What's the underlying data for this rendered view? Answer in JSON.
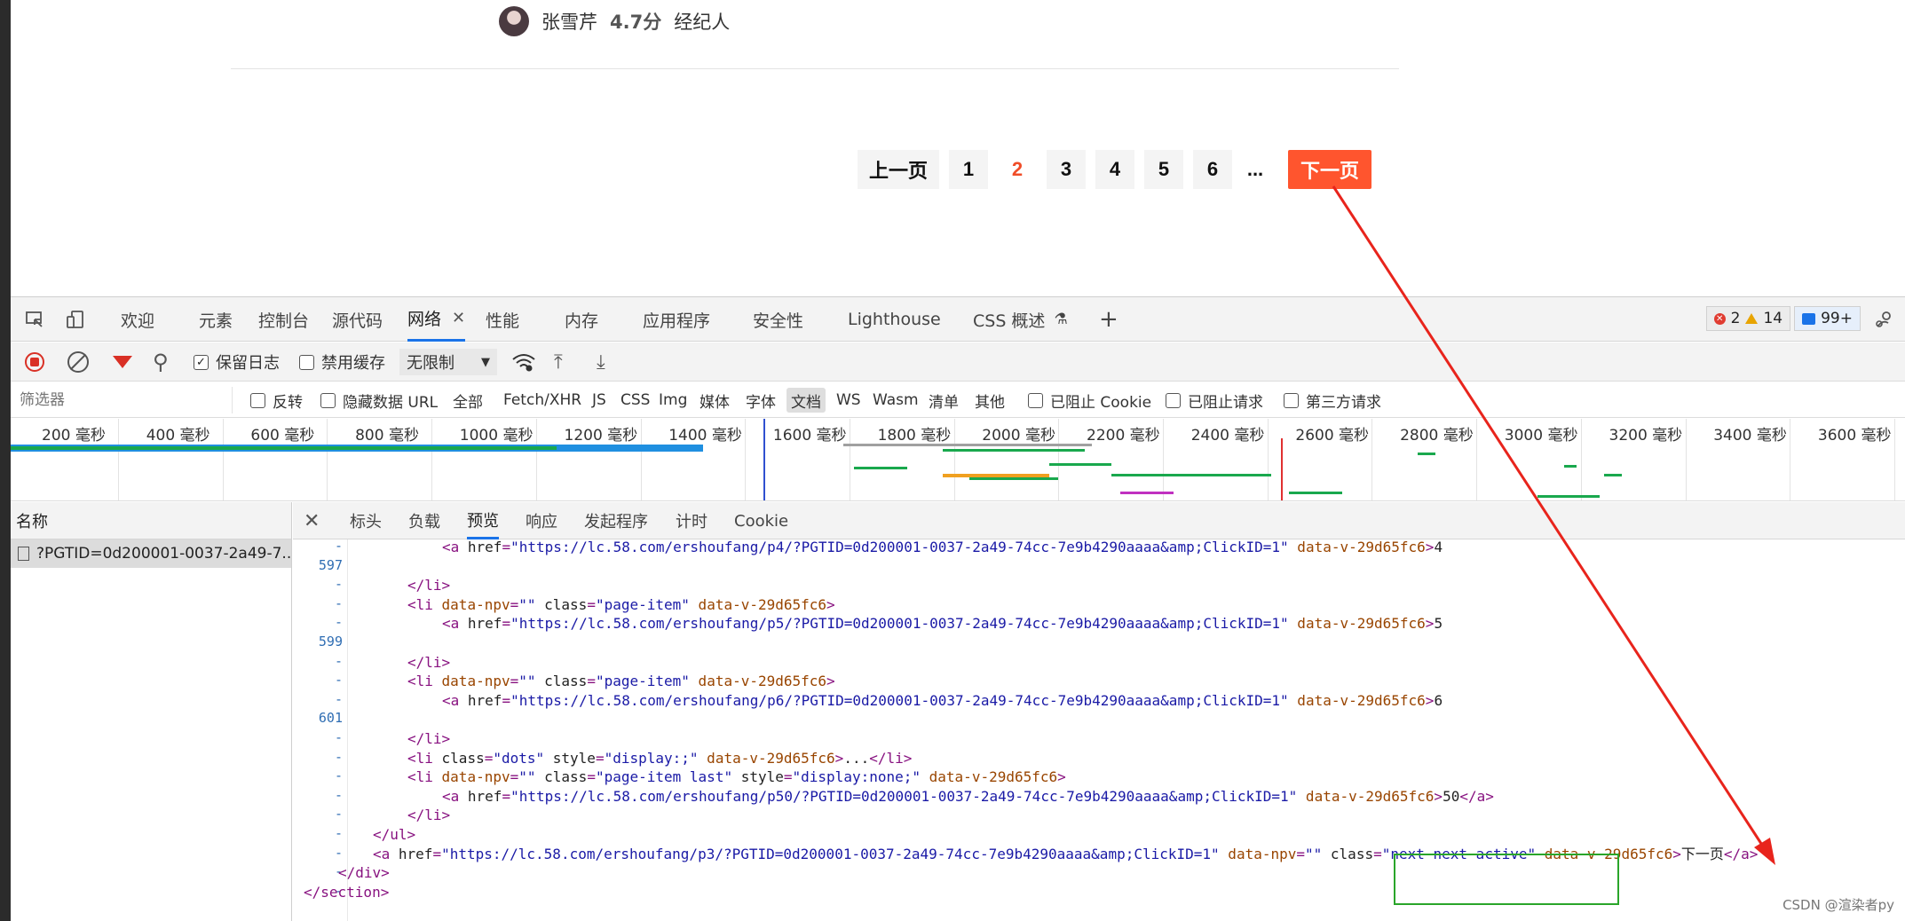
{
  "agent": {
    "name": "张雪芹",
    "score": "4.7分",
    "role": "经纪人"
  },
  "pagination": {
    "prev": "上一页",
    "pages": [
      "1",
      "2",
      "3",
      "4",
      "5",
      "6"
    ],
    "current": "2",
    "ellipsis": "...",
    "next": "下一页"
  },
  "devtools": {
    "tabs": [
      "欢迎",
      "元素",
      "控制台",
      "源代码",
      "网络",
      "性能",
      "内存",
      "应用程序",
      "安全性",
      "Lighthouse",
      "CSS 概述"
    ],
    "active_tab": "网络",
    "counts": {
      "errors": "2",
      "warnings": "14",
      "messages": "99+"
    },
    "toolbar": {
      "preserve_log": "保留日志",
      "disable_cache": "禁用缓存",
      "throttle": "无限制"
    },
    "filter": {
      "placeholder": "筛选器",
      "invert": "反转",
      "hide_data_urls": "隐藏数据 URL",
      "types": [
        "全部",
        "Fetch/XHR",
        "JS",
        "CSS",
        "Img",
        "媒体",
        "字体",
        "文档",
        "WS",
        "Wasm",
        "清单",
        "其他"
      ],
      "selected_type": "文档",
      "blocked_cookies": "已阻止 Cookie",
      "blocked_requests": "已阻止请求",
      "third_party": "第三方请求"
    },
    "timeline_labels": [
      "200 毫秒",
      "400 毫秒",
      "600 毫秒",
      "800 毫秒",
      "1000 毫秒",
      "1200 毫秒",
      "1400 毫秒",
      "1600 毫秒",
      "1800 毫秒",
      "2000 毫秒",
      "2200 毫秒",
      "2400 毫秒",
      "2600 毫秒",
      "2800 毫秒",
      "3000 毫秒",
      "3200 毫秒",
      "3400 毫秒",
      "3600 毫秒"
    ],
    "name_header": "名称",
    "request_name": "?PGTID=0d200001-0037-2a49-7...",
    "detail_tabs": [
      "标头",
      "负载",
      "预览",
      "响应",
      "发起程序",
      "计时",
      "Cookie"
    ],
    "active_detail_tab": "预览",
    "line_numbers": [
      "-",
      "597",
      "-",
      "-",
      "-",
      "599",
      "-",
      "-",
      "-",
      "601",
      "-",
      "-",
      "-",
      "-",
      "-",
      "-",
      "-",
      "-",
      "-"
    ],
    "code_lines": [
      "        <a href=\"https://lc.58.com/ershoufang/p4/?PGTID=0d200001-0037-2a49-74cc-7e9b4290aaaa&amp;ClickID=1\" data-v-29d65fc6>4",
      "",
      "    </li>",
      "    <li data-npv=\"\" class=\"page-item\" data-v-29d65fc6>",
      "        <a href=\"https://lc.58.com/ershoufang/p5/?PGTID=0d200001-0037-2a49-74cc-7e9b4290aaaa&amp;ClickID=1\" data-v-29d65fc6>5",
      "",
      "    </li>",
      "    <li data-npv=\"\" class=\"page-item\" data-v-29d65fc6>",
      "        <a href=\"https://lc.58.com/ershoufang/p6/?PGTID=0d200001-0037-2a49-74cc-7e9b4290aaaa&amp;ClickID=1\" data-v-29d65fc6>6",
      "",
      "    </li>",
      "    <li class=\"dots\" style=\"display:;\" data-v-29d65fc6>...</li>",
      "    <li data-npv=\"\" class=\"page-item last\" style=\"display:none;\" data-v-29d65fc6>",
      "        <a href=\"https://lc.58.com/ershoufang/p50/?PGTID=0d200001-0037-2a49-74cc-7e9b4290aaaa&amp;ClickID=1\" data-v-29d65fc6>50</a>",
      "    </li>",
      "</ul>",
      "<a href=\"https://lc.58.com/ershoufang/p3/?PGTID=0d200001-0037-2a49-74cc-7e9b4290aaaa&amp;ClickID=1\" data-npv=\"\" class=\"next next-active\" data-v-29d65fc6>下一页</a>",
      "</div>",
      "</section>"
    ],
    "code_indents": [
      2,
      0,
      1,
      1,
      2,
      0,
      1,
      1,
      2,
      0,
      1,
      1,
      1,
      2,
      1,
      0,
      0,
      -1,
      -2
    ]
  },
  "annotation": {
    "box_color": "#2aa52a",
    "arrow_color": "#e8241c"
  },
  "watermark": "CSDN @渲染者py",
  "colors": {
    "accent": "#ff552e",
    "current_page": "#f04d28",
    "devtools_active": "#1a73e8"
  }
}
